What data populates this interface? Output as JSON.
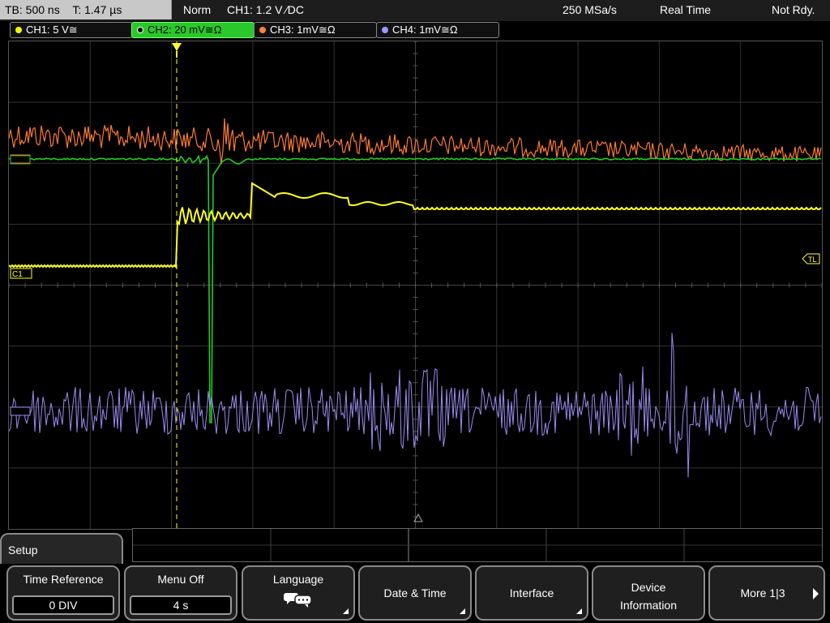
{
  "status_bar": {
    "timebase": "TB: 500 ns",
    "trigger_time": "T: 1.47 µs",
    "acq_mode": "Norm",
    "trigger_info": "CH1: 1.2 V ∕DC",
    "sample_rate": "250 MSa/s",
    "mode": "Real Time",
    "state": "Not Rdy."
  },
  "channels": [
    {
      "label": "CH1: 5 V≅",
      "color": "#f5f50a",
      "active": false
    },
    {
      "label": "CH2: 20 mV≅Ω",
      "color": "#22d322",
      "active": true
    },
    {
      "label": "CH3: 1mV≅Ω",
      "color": "#ff8040",
      "active": false
    },
    {
      "label": "CH4: 1mV≅Ω",
      "color": "#9a9aff",
      "active": false
    }
  ],
  "markers": {
    "ch1": "C1",
    "tl": "TL",
    "trig": "T"
  },
  "colors": {
    "ch1": "#ffff20",
    "ch2": "#22cc22",
    "ch3": "#ff7a30",
    "ch4": "#9a8cf0",
    "grid": "#333333"
  },
  "menu": {
    "title": "Setup",
    "softkeys": [
      {
        "label": "Time Reference",
        "value": "0 DIV"
      },
      {
        "label": "Menu Off",
        "value": "4 s"
      },
      {
        "label": "Language",
        "icon": "speech-bubbles-icon"
      },
      {
        "label": "Date & Time"
      },
      {
        "label": "Interface"
      },
      {
        "label": "Device Information"
      },
      {
        "label": "More 1|3"
      }
    ]
  }
}
